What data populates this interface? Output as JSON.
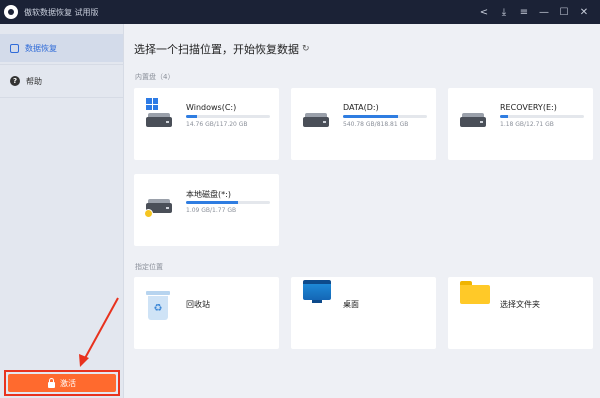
{
  "titlebar": {
    "title": "傲软数据恢复 试用版",
    "controls": [
      {
        "name": "share-icon",
        "glyph": "<"
      },
      {
        "name": "save-icon",
        "glyph": "⤓"
      },
      {
        "name": "menu-icon",
        "glyph": "≡"
      },
      {
        "name": "minimize-icon",
        "glyph": "—"
      },
      {
        "name": "maximize-icon",
        "glyph": "☐"
      },
      {
        "name": "close-icon",
        "glyph": "✕"
      }
    ]
  },
  "sidebar": {
    "items": [
      {
        "label": "数据恢复",
        "icon": "recover-icon",
        "active": true
      },
      {
        "label": "帮助",
        "icon": "help-icon",
        "active": false
      }
    ],
    "activate_label": "激活"
  },
  "main": {
    "heading": "选择一个扫描位置，开始恢复数据",
    "refresh_glyph": "↻",
    "internal_label": "内置盘（4）",
    "drives": [
      {
        "name": "Windows(C:)",
        "size": "14.76 GB/117.20 GB",
        "usage": 0.126,
        "icon": "system-drive-icon"
      },
      {
        "name": "DATA(D:)",
        "size": "540.78 GB/818.81 GB",
        "usage": 0.66,
        "icon": "hard-drive-icon"
      },
      {
        "name": "RECOVERY(E:)",
        "size": "1.18 GB/12.71 GB",
        "usage": 0.093,
        "icon": "hard-drive-icon"
      },
      {
        "name": "本地磁盘(*:)",
        "size": "1.09 GB/1.77 GB",
        "usage": 0.616,
        "icon": "usb-drive-icon"
      }
    ],
    "location_label": "指定位置",
    "locations": [
      {
        "name": "回收站",
        "icon": "recycle-bin-icon"
      },
      {
        "name": "桌面",
        "icon": "desktop-icon"
      },
      {
        "name": "选择文件夹",
        "icon": "folder-icon"
      }
    ]
  },
  "colors": {
    "titlebar": "#1b2236",
    "accent": "#2f7de1",
    "activate": "#ff6a2e",
    "highlight": "#e8321e"
  }
}
